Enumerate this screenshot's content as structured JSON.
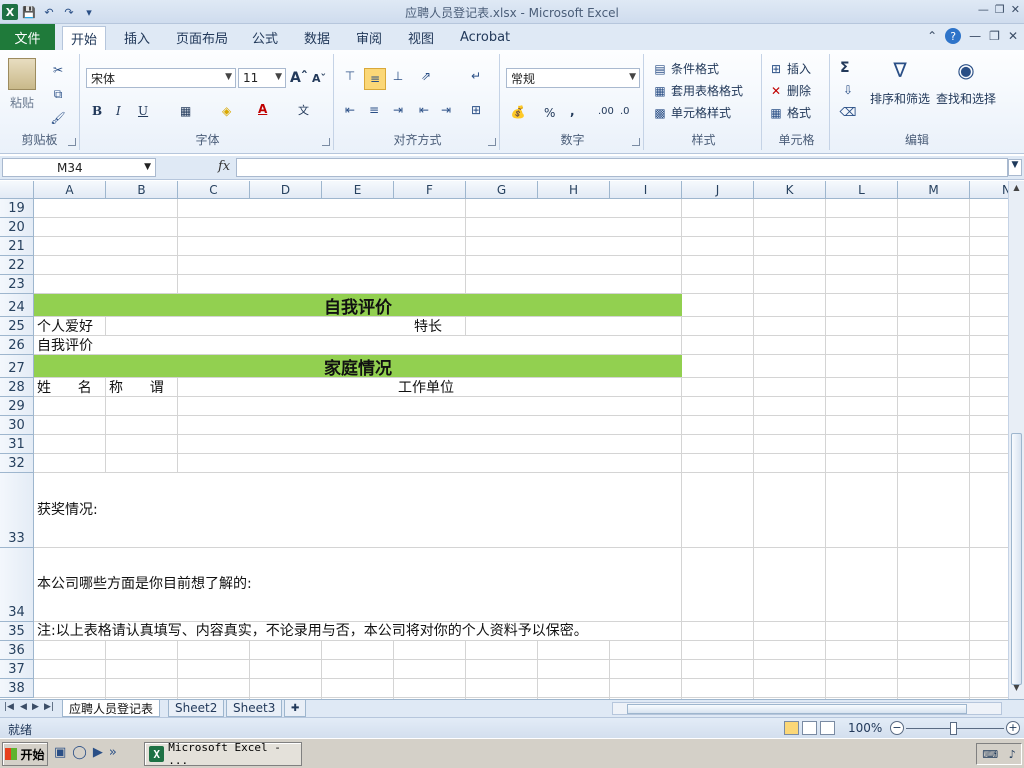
{
  "window": {
    "title": "应聘人员登记表.xlsx  -  Microsoft Excel"
  },
  "ribbon_tabs": {
    "file": "文件",
    "items": [
      "开始",
      "插入",
      "页面布局",
      "公式",
      "数据",
      "审阅",
      "视图",
      "Acrobat"
    ],
    "active": "开始"
  },
  "ribbon": {
    "clipboard": {
      "label": "剪贴板",
      "paste": "粘贴"
    },
    "font": {
      "label": "字体",
      "name": "宋体",
      "size": "11"
    },
    "alignment": {
      "label": "对齐方式"
    },
    "number": {
      "label": "数字",
      "format": "常规"
    },
    "styles": {
      "label": "样式",
      "conditional": "条件格式",
      "table": "套用表格格式",
      "cell_styles": "单元格样式"
    },
    "cells": {
      "label": "单元格",
      "insert": "插入",
      "delete": "删除",
      "format": "格式"
    },
    "editing": {
      "label": "编辑",
      "sort": "排序和筛选",
      "find": "查找和选择"
    }
  },
  "formula_bar": {
    "name_box": "M34",
    "fx": "fx",
    "value": ""
  },
  "columns": [
    "A",
    "B",
    "C",
    "D",
    "E",
    "F",
    "G",
    "H",
    "I",
    "J",
    "K",
    "L",
    "M",
    "N"
  ],
  "rows": [
    "19",
    "20",
    "21",
    "22",
    "23",
    "24",
    "25",
    "26",
    "27",
    "28",
    "29",
    "30",
    "31",
    "32",
    "33",
    "34",
    "35",
    "36",
    "37",
    "38"
  ],
  "cells": {
    "self_eval_header": "自我评价",
    "hobby": "个人爱好",
    "specialty": "特长",
    "self_eval": "自我评价",
    "family_header": "家庭情况",
    "name": "姓      名",
    "title": "称      谓",
    "work_unit": "工作单位",
    "awards": "获奖情况:",
    "wants_to_know": "本公司哪些方面是你目前想了解的:",
    "note": "注:以上表格请认真填写、内容真实，不论录用与否，本公司将对你的个人资料予以保密。"
  },
  "colors": {
    "band_green": "#92d050",
    "file_tab": "#1f7a3a"
  },
  "sheet_tabs": [
    "应聘人员登记表",
    "Sheet2",
    "Sheet3"
  ],
  "active_sheet": "应聘人员登记表",
  "status": {
    "ready": "就绪",
    "zoom": "100%"
  },
  "taskbar": {
    "start": "开始",
    "item": "Microsoft Excel - ..."
  }
}
